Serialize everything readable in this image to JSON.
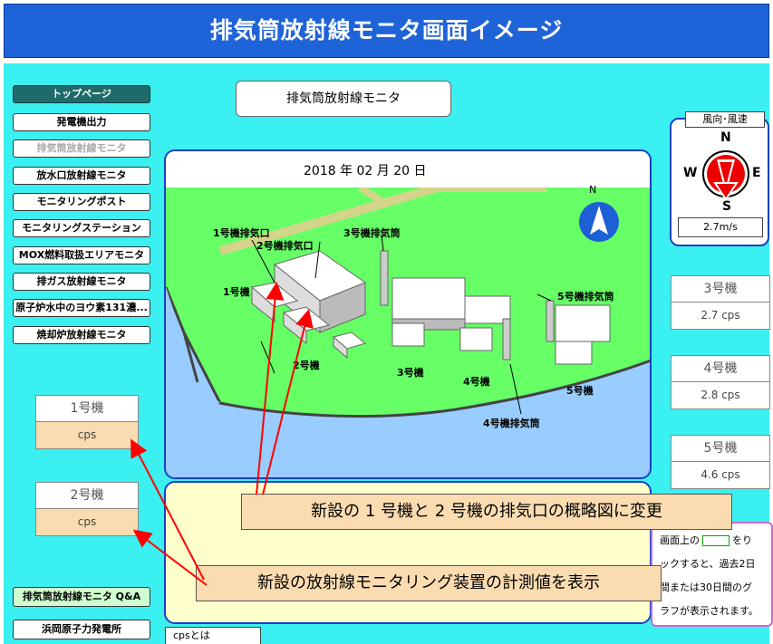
{
  "banner": {
    "title": "排気筒放射線モニタ画面イメージ"
  },
  "nav": {
    "items": [
      "トップページ",
      "発電機出力",
      "排気筒放射線モニタ",
      "放水口放射線モニタ",
      "モニタリングポスト",
      "モニタリングステーション",
      "MOX燃料取扱エリアモニタ",
      "排ガス放射線モニタ",
      "原子炉水中のヨウ素131濃...",
      "焼却炉放射線モニタ"
    ],
    "qa": "排気筒放射線モニタ Q&A",
    "hamaoka": "浜岡原子力発電所"
  },
  "page_title": "排気筒放射線モニタ",
  "map": {
    "date": "2018 年 02 月 20 日",
    "north": "N",
    "labels": {
      "u1_exhaust": "1号機排気口",
      "u2_exhaust": "2号機排気口",
      "u3_stack": "3号機排気筒",
      "u5_stack": "5号機排気筒",
      "u1": "1号機",
      "u2": "2号機",
      "u3": "3号機",
      "u4": "4号機",
      "u5": "5号機",
      "u4_stack": "4号機排気筒"
    }
  },
  "units_left": [
    {
      "name": "1号機",
      "value": "cps"
    },
    {
      "name": "2号機",
      "value": "cps"
    }
  ],
  "units_right": [
    {
      "name": "3号機",
      "value": "2.7 cps"
    },
    {
      "name": "4号機",
      "value": "2.8 cps"
    },
    {
      "name": "5号機",
      "value": "4.6 cps"
    }
  ],
  "wind": {
    "title": "風向･風速",
    "n": "N",
    "s": "S",
    "e": "E",
    "w": "W",
    "speed": "2.7m/s"
  },
  "callouts": {
    "top": "新設の 1 号機と 2 号機の排気口の概略図に変更",
    "bottom": "新設の放射線モニタリング装置の計測値を表示"
  },
  "info": {
    "line1a": "画面上の",
    "line1b": "をり",
    "line2": "ックすると、過去2日",
    "line3": "間または30日間のグ",
    "line4": "ラフが表示されます。"
  },
  "cps_link": "cpsとは",
  "colors": {
    "banner": "#1e64d8",
    "background": "#3bf0f0",
    "sea": "#99ccff",
    "land": "#66ff66",
    "callout": "#fbdcb0",
    "arrow": "#ff0000"
  }
}
